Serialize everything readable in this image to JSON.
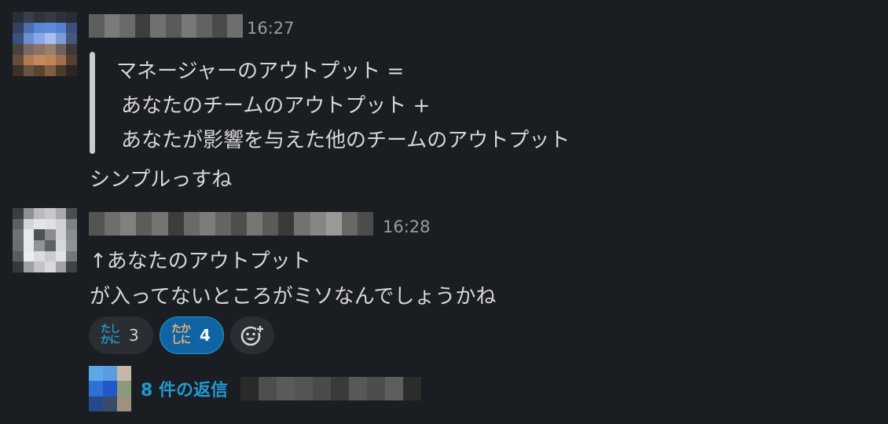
{
  "messages": [
    {
      "timestamp": "16:27",
      "quote_lines": [
        "マネージャーのアウトプット =",
        "あなたのチームのアウトプット +",
        "あなたが影響を与えた他のチームのアウトプット"
      ],
      "text": "シンプルっすね"
    },
    {
      "timestamp": "16:28",
      "lines": [
        "↑あなたのアウトプット",
        "が入ってないところがミソなんでしょうかね"
      ],
      "reactions": [
        {
          "emoji_line1": "たし",
          "emoji_line2": "かに",
          "count": "3",
          "active": false
        },
        {
          "emoji_line1": "たか",
          "emoji_line2": "しに",
          "count": "4",
          "active": true
        }
      ],
      "add_reaction_icon": "add-emoji-icon",
      "thread": {
        "reply_count": "8 件の返信"
      }
    }
  ],
  "colors": {
    "background": "#1a1d21",
    "text": "#d6d7d9",
    "timestamp": "#9a9b9e",
    "link": "#1d9bd1",
    "reaction_active_bg": "#1164a3"
  }
}
